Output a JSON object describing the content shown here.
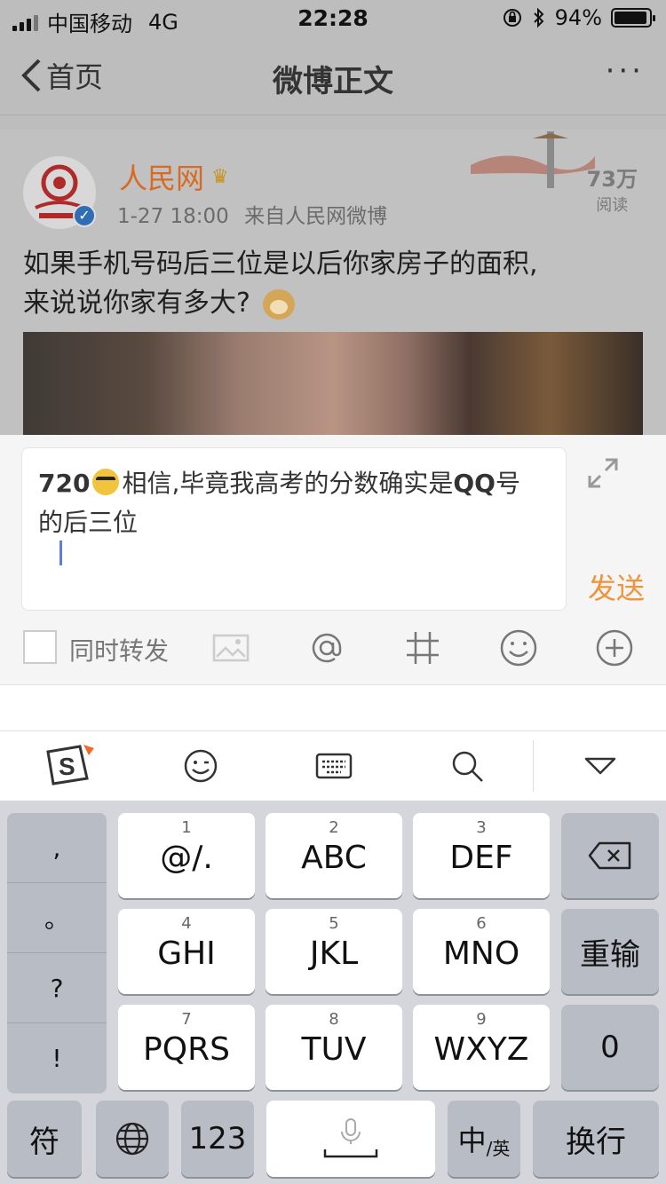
{
  "status_bar": {
    "carrier": "中国移动",
    "network": "4G",
    "time": "22:28",
    "battery": "94%",
    "battery_level": 0.94
  },
  "nav": {
    "back_label": "首页",
    "title": "微博正文",
    "more": "···"
  },
  "post": {
    "author": "人民网",
    "timestamp": "1-27 18:00",
    "source": "来自人民网微博",
    "reads_count": "73万",
    "reads_label": "阅读",
    "text_line1": "如果手机号码后三位是以后你家房子的面积,",
    "text_line2": "来说说你家有多大?"
  },
  "compose": {
    "text_prefix": "720",
    "text_part1": "相信,毕竟我高考的分数确实是",
    "text_bold": "QQ",
    "text_part2": "号",
    "text_line2": "的后三位",
    "send_label": "发送",
    "repost_label": "同时转发"
  },
  "keyboard": {
    "punctuation": [
      ",",
      "。",
      "?",
      "!"
    ],
    "keys": [
      {
        "num": "1",
        "label": "@/."
      },
      {
        "num": "2",
        "label": "ABC"
      },
      {
        "num": "3",
        "label": "DEF"
      },
      {
        "num": "4",
        "label": "GHI"
      },
      {
        "num": "5",
        "label": "JKL"
      },
      {
        "num": "6",
        "label": "MNO"
      },
      {
        "num": "7",
        "label": "PQRS"
      },
      {
        "num": "8",
        "label": "TUV"
      },
      {
        "num": "9",
        "label": "WXYZ"
      }
    ],
    "reenter": "重输",
    "zero": "0",
    "symbols": "符",
    "numbers": "123",
    "lang_main": "中",
    "lang_sub": "/英",
    "enter": "换行"
  },
  "colors": {
    "accent_orange": "#f0943a",
    "author_orange": "#d86a21",
    "verified_blue": "#2f6db4",
    "caret_blue": "#5b7fdc"
  }
}
